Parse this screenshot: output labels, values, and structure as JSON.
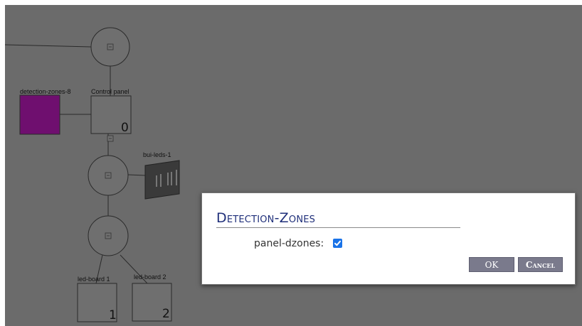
{
  "diagram": {
    "nodes": {
      "detection_zones_label": "detection-zones-8",
      "control_panel_label": "Control panel",
      "control_panel_number": "0",
      "bui_leds_label": "bui-leds-1",
      "led_board_1_label": "led-board 1",
      "led_board_1_number": "1",
      "led_board_2_label": "led-board 2",
      "led_board_2_number": "2"
    },
    "colors": {
      "canvas_bg": "#6b6b6b",
      "node_fill": "#6f6f6f",
      "detection_zone_fill": "#6f0f6f",
      "line": "#2a2a2a"
    }
  },
  "dialog": {
    "title": "Detection-Zones",
    "field_label": "panel-dzones:",
    "field_checked": true,
    "ok_label": "OK",
    "cancel_label": "Cancel"
  }
}
